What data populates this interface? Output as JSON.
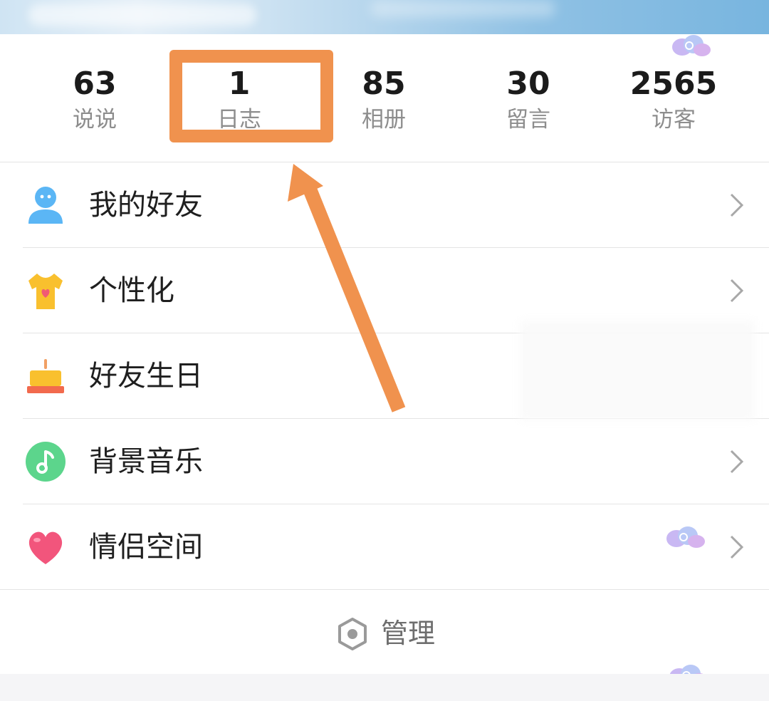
{
  "stats": [
    {
      "value": "63",
      "label": "说说"
    },
    {
      "value": "1",
      "label": "日志"
    },
    {
      "value": "85",
      "label": "相册"
    },
    {
      "value": "30",
      "label": "留言"
    },
    {
      "value": "2565",
      "label": "访客"
    }
  ],
  "menu": [
    {
      "label": "我的好友",
      "icon": "person-icon"
    },
    {
      "label": "个性化",
      "icon": "tshirt-icon"
    },
    {
      "label": "好友生日",
      "icon": "birthday-cake-icon"
    },
    {
      "label": "背景音乐",
      "icon": "music-note-icon"
    },
    {
      "label": "情侣空间",
      "icon": "heart-icon"
    }
  ],
  "manage": {
    "label": "管理",
    "icon": "hexagon-gear-icon"
  },
  "colors": {
    "highlight": "#f0924e",
    "music_green": "#5cd58c",
    "heart_pink": "#f2557c"
  }
}
